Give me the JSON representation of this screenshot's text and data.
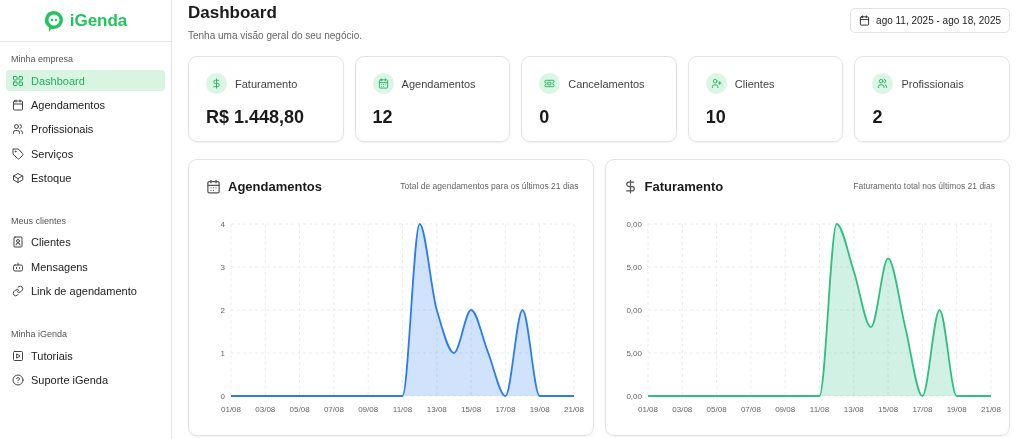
{
  "brand": {
    "name": "iGenda"
  },
  "sidebar": {
    "sections": [
      {
        "title": "Minha empresa",
        "items": [
          {
            "label": "Dashboard",
            "selected": true
          },
          {
            "label": "Agendamentos",
            "selected": false
          },
          {
            "label": "Profissionais",
            "selected": false
          },
          {
            "label": "Serviços",
            "selected": false
          },
          {
            "label": "Estoque",
            "selected": false
          }
        ]
      },
      {
        "title": "Meus clientes",
        "items": [
          {
            "label": "Clientes",
            "selected": false
          },
          {
            "label": "Mensagens",
            "selected": false
          },
          {
            "label": "Link de agendamento",
            "selected": false
          }
        ]
      },
      {
        "title": "Minha iGenda",
        "items": [
          {
            "label": "Tutoriais",
            "selected": false
          },
          {
            "label": "Suporte iGenda",
            "selected": false
          }
        ]
      }
    ]
  },
  "header": {
    "title": "Dashboard",
    "subtitle": "Tenha uma visão geral do seu negócio.",
    "date_range": "ago 11, 2025 - ago 18, 2025"
  },
  "stats": [
    {
      "label": "Faturamento",
      "value": "R$ 1.448,80"
    },
    {
      "label": "Agendamentos",
      "value": "12"
    },
    {
      "label": "Cancelamentos",
      "value": "0"
    },
    {
      "label": "Clientes",
      "value": "10"
    },
    {
      "label": "Profissionais",
      "value": "2"
    }
  ],
  "charts": [
    {
      "title": "Agendamentos",
      "subtitle": "Total de agendamentos para os últimos 21 dias",
      "chart_data": {
        "type": "area",
        "grid": true,
        "categories": [
          "01/08",
          null,
          "03/08",
          null,
          "05/08",
          null,
          "07/08",
          null,
          "09/08",
          null,
          "11/08",
          null,
          "13/08",
          null,
          "15/08",
          null,
          "17/08",
          null,
          "19/08",
          null,
          "21/08"
        ],
        "ylim": [
          0,
          4
        ],
        "yticks": [
          0,
          1,
          2,
          3,
          4
        ],
        "series": [
          {
            "color": "#2b7cf0",
            "values": [
              0,
              0,
              0,
              0,
              0,
              0,
              0,
              0,
              0,
              0,
              0,
              4,
              2,
              1,
              2,
              1,
              0,
              2,
              0,
              0,
              0
            ]
          }
        ]
      }
    },
    {
      "title": "Faturamento",
      "subtitle": "Faturamento total nos últimos 21 dias",
      "y_axis_labels": [
        "0,00",
        "5,00",
        "0,00",
        "5,00",
        "0,00"
      ],
      "x_axis_labels": [
        "01/08",
        "03/08",
        "05/08",
        "07/08",
        "09/08",
        "11/08",
        "13/08",
        "15/08",
        "17/08",
        "19/08",
        "21/08"
      ]
    }
  ]
}
